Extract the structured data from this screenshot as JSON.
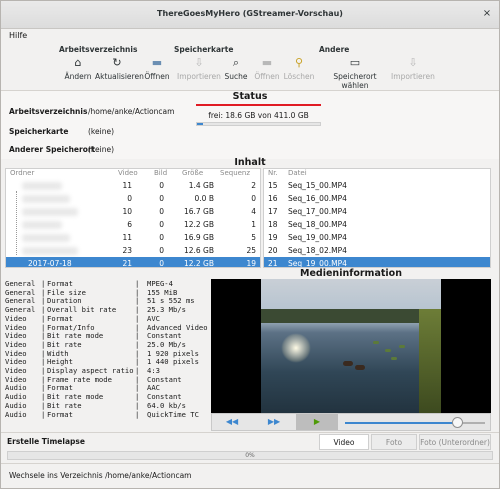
{
  "window": {
    "title": "ThereGoesMyHero (GStreamer-Vorschau)",
    "close_glyph": "×"
  },
  "menu": {
    "help": "Hilfe"
  },
  "toolbar": {
    "groups": {
      "dir": "Arbeitsverzeichnis",
      "card": "Speicherkarte",
      "other": "Andere"
    },
    "buttons": {
      "change": "Ändern",
      "refresh": "Aktualisieren",
      "open_dir": "Öffnen",
      "import_card": "Importieren",
      "search": "Suche",
      "open_card": "Öffnen",
      "delete": "Löschen",
      "choose_location": "Speicherort wählen",
      "import_other": "Importieren"
    },
    "icons": {
      "change": "home-icon",
      "refresh": "refresh-icon",
      "open_dir": "folder-icon",
      "import_card": "import-icon",
      "search": "search-icon",
      "open_card": "folder-icon",
      "delete": "broom-icon",
      "choose_location": "drive-icon",
      "import_other": "import-icon"
    }
  },
  "status": {
    "heading": "Status",
    "free_text": "frei: 18.6 GB von 411.0 GB",
    "free_fraction": 0.045,
    "workdir_label": "Arbeitsverzeichnis",
    "workdir_value": "/home/anke/Actioncam",
    "card_label": "Speicherkarte",
    "card_value": "(keine)",
    "other_label": "Anderer Speicherort",
    "other_value": "(keine)"
  },
  "content": {
    "heading": "Inhalt",
    "columns": {
      "folder": "Ordner",
      "video": "Video",
      "image": "Bild",
      "size": "Größe",
      "seq": "Sequenz"
    },
    "folders": [
      {
        "name": "",
        "video": "11",
        "image": "0",
        "size": "1.4 GB",
        "seq": "2"
      },
      {
        "name": "",
        "video": "0",
        "image": "0",
        "size": "0.0 B",
        "seq": "0"
      },
      {
        "name": "",
        "video": "10",
        "image": "0",
        "size": "16.7 GB",
        "seq": "4"
      },
      {
        "name": "",
        "video": "6",
        "image": "0",
        "size": "12.2 GB",
        "seq": "1"
      },
      {
        "name": "",
        "video": "11",
        "image": "0",
        "size": "16.9 GB",
        "seq": "5"
      },
      {
        "name": "",
        "video": "23",
        "image": "0",
        "size": "12.6 GB",
        "seq": "25"
      },
      {
        "name": "2017-07-18",
        "video": "21",
        "image": "0",
        "size": "12.2 GB",
        "seq": "19"
      }
    ],
    "file_columns": {
      "nr": "Nr.",
      "file": "Datei"
    },
    "files": [
      {
        "nr": "15",
        "name": "Seq_15_00.MP4"
      },
      {
        "nr": "16",
        "name": "Seq_16_00.MP4"
      },
      {
        "nr": "17",
        "name": "Seq_17_00.MP4"
      },
      {
        "nr": "18",
        "name": "Seq_18_00.MP4"
      },
      {
        "nr": "19",
        "name": "Seq_19_00.MP4"
      },
      {
        "nr": "20",
        "name": "Seq_18_02.MP4"
      },
      {
        "nr": "21",
        "name": "Seq_19_00.MP4"
      }
    ]
  },
  "mediainfo": {
    "heading": "Medieninformation",
    "rows": [
      {
        "section": "General",
        "key": "Format",
        "value": "MPEG-4"
      },
      {
        "section": "General",
        "key": "File size",
        "value": "155 MiB"
      },
      {
        "section": "General",
        "key": "Duration",
        "value": "51 s 552 ms"
      },
      {
        "section": "General",
        "key": "Overall bit rate",
        "value": "25.3 Mb/s"
      },
      {
        "section": "Video",
        "key": "Format",
        "value": "AVC"
      },
      {
        "section": "Video",
        "key": "Format/Info",
        "value": "Advanced Video"
      },
      {
        "section": "Video",
        "key": "Bit rate mode",
        "value": "Constant"
      },
      {
        "section": "Video",
        "key": "Bit rate",
        "value": "25.0 Mb/s"
      },
      {
        "section": "Video",
        "key": "Width",
        "value": "1 920 pixels"
      },
      {
        "section": "Video",
        "key": "Height",
        "value": "1 440 pixels"
      },
      {
        "section": "Video",
        "key": "Display aspect ratio",
        "value": "4:3"
      },
      {
        "section": "Video",
        "key": "Frame rate mode",
        "value": "Constant"
      },
      {
        "section": "Audio",
        "key": "Format",
        "value": "AAC"
      },
      {
        "section": "Audio",
        "key": "Bit rate mode",
        "value": "Constant"
      },
      {
        "section": "Audio",
        "key": "Bit rate",
        "value": "64.0 kb/s"
      },
      {
        "section": "Audio",
        "key": "Format",
        "value": "QuickTime TC"
      }
    ],
    "separator": "|"
  },
  "player": {
    "rewind": "◀◀",
    "forward": "▶▶",
    "play": "▶",
    "position_fraction": 0.8
  },
  "timelapse": {
    "label": "Erstelle Timelapse",
    "tabs": [
      "Video",
      "Foto",
      "Foto (Unterordner)"
    ],
    "progress_text": "0%"
  },
  "statusbar": {
    "message": "Wechsele ins Verzeichnis /home/anke/Actioncam"
  },
  "colors": {
    "selection": "#3d87cf",
    "accent_red": "#e01b24",
    "play_green": "#4e9a06"
  }
}
